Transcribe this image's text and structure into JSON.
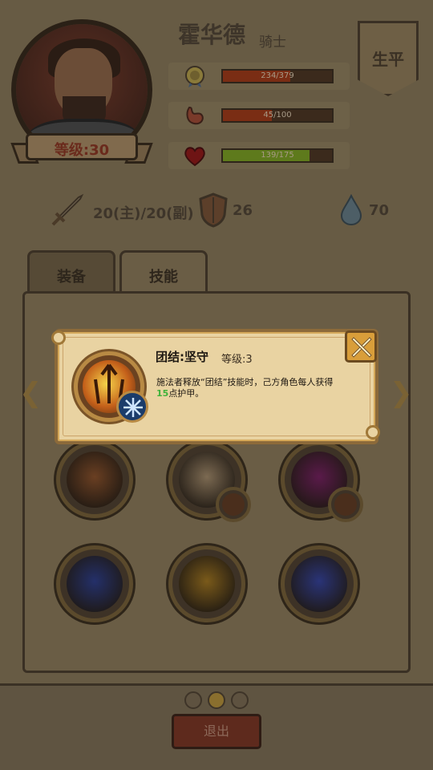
{
  "hero": {
    "name": "霍华德",
    "class": "骑士",
    "level_label": "等级:30",
    "career_button": "生平"
  },
  "stats": [
    {
      "icon": "medal-icon",
      "value_text": "234/379",
      "ratio": 0.617,
      "color": "#7a2d14"
    },
    {
      "icon": "stomach-icon",
      "value_text": "45/100",
      "ratio": 0.45,
      "color": "#7a2d14"
    },
    {
      "icon": "heart-icon",
      "value_text": "139/175",
      "ratio": 0.794,
      "color": "#5e7a1c"
    }
  ],
  "attributes": {
    "attack": "20(主)/20(副)",
    "defense": "26",
    "mana": "70"
  },
  "tabs": [
    {
      "label": "装备",
      "active": false
    },
    {
      "label": "技能",
      "active": true
    }
  ],
  "tooltip": {
    "title": "团结:坚守",
    "level": "等级:3",
    "desc_before": "施法者释放“团结”技能时，己方角色每人获得",
    "desc_number": "15",
    "desc_after": "点护甲。"
  },
  "skills": [
    {
      "icon": "tree-stump-skill-icon",
      "color": "#6a3f22",
      "has_sub": false
    },
    {
      "icon": "whirlwind-skill-icon",
      "color": "#7c6a52",
      "has_sub": true
    },
    {
      "icon": "demon-eye-skill-icon",
      "color": "#5a1a4a",
      "has_sub": true
    },
    {
      "icon": "lightning-crystal-skill-icon",
      "color": "#24306a",
      "has_sub": false
    },
    {
      "icon": "rock-golem-skill-icon",
      "color": "#7a5a1a",
      "has_sub": false
    },
    {
      "icon": "ice-shard-skill-icon",
      "color": "#2a3478",
      "has_sub": false
    }
  ],
  "pagination": {
    "pages": 3,
    "current": 2
  },
  "exit_button": "退出"
}
